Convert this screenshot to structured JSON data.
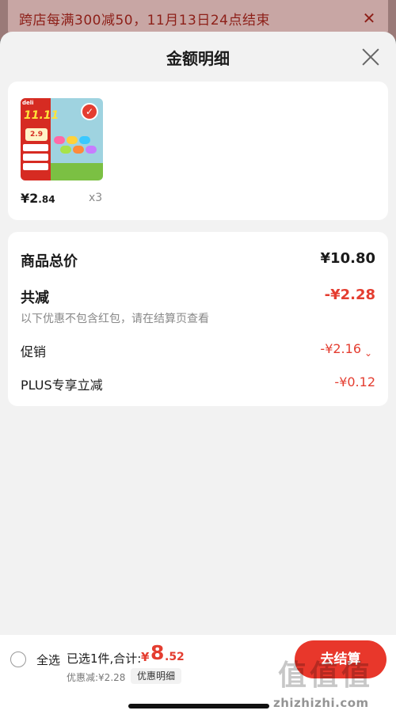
{
  "promo": {
    "text": "跨店每满300减50，11月13日24点结束",
    "close_icon": "close-icon"
  },
  "sheet": {
    "title": "金额明细",
    "close_icon": "close-icon"
  },
  "product": {
    "image_icon": "product-thumbnail",
    "selected_icon": "check-icon",
    "thumb_logo": "deli",
    "thumb_big": "11.11",
    "thumb_price": "2.9",
    "price_currency": "¥",
    "price_int": "2",
    "price_dec": ".84",
    "quantity": "x3"
  },
  "summary": {
    "total_label": "商品总价",
    "total_value": "¥10.80",
    "reduce_label": "共减",
    "reduce_value": "-¥2.28",
    "note": "以下优惠不包含红包，请在结算页查看",
    "promo_label": "促销",
    "promo_value": "-¥2.16",
    "plus_label": "PLUS专享立减",
    "plus_value": "-¥0.12",
    "expand_icon": "chevron-down-icon"
  },
  "bottom": {
    "select_all": "全选",
    "selected_text": "已选1件,合计:",
    "total_currency": "¥",
    "total_int": "8",
    "total_dec": ".52",
    "discount_text": "优惠减:¥2.28",
    "detail_chip": "优惠明细",
    "checkout": "去结算"
  },
  "watermark": {
    "badge": "值值值",
    "text": "zhizhizhi.com"
  },
  "colors": {
    "accent_red": "#e43d30",
    "checkout_red": "#e8372b",
    "sheet_bg": "#f2f2f2"
  }
}
